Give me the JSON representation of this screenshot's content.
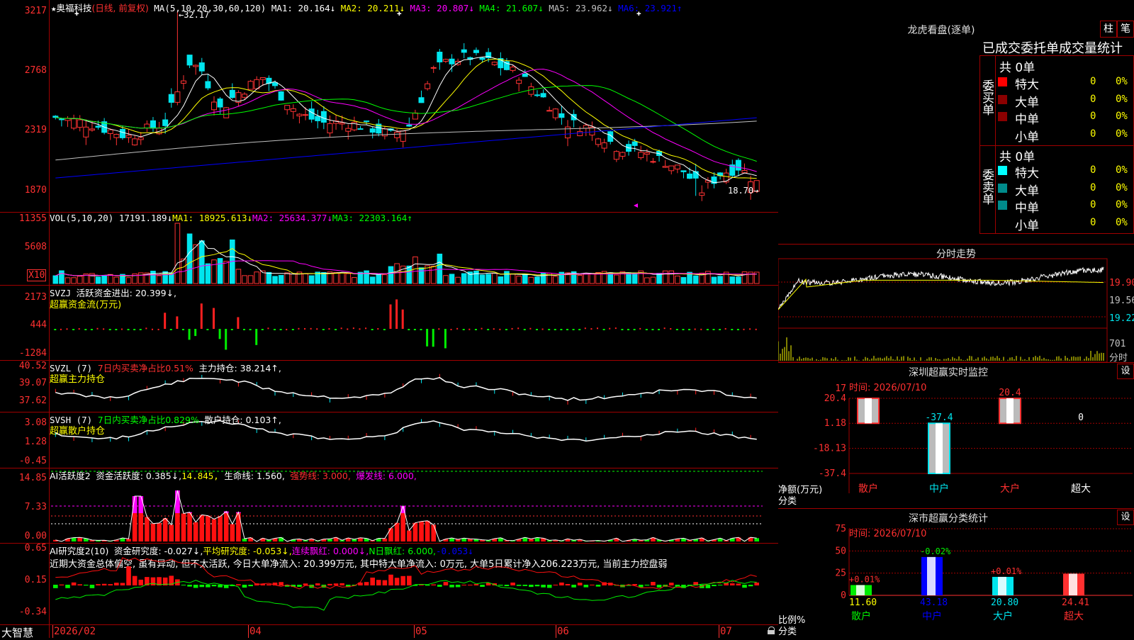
{
  "colors": {
    "up": "#ff3333",
    "down": "#00e5ee",
    "grid": "#a00000"
  },
  "kline": {
    "star": "★",
    "name": "奥福科技",
    "mode": "(日线, 前复权)",
    "ma_label": "MA(5,10,20,30,60,120)",
    "ma_values": [
      {
        "label": "MA1: 20.164↓",
        "color": "#ffffff"
      },
      {
        "label": "MA2: 20.211↓",
        "color": "#ffff00"
      },
      {
        "label": "MA3: 20.807↓",
        "color": "#ff00ff"
      },
      {
        "label": "MA4: 21.607↓",
        "color": "#00ff00"
      },
      {
        "label": "MA5: 23.962↓",
        "color": "#c0c0c0"
      },
      {
        "label": "MA6: 23.921↑",
        "color": "#0000ff"
      }
    ],
    "y_ticks": [
      "3217",
      "2768",
      "2319",
      "1870"
    ],
    "high_label": "←32.17",
    "low_label": "18.70→"
  },
  "volume": {
    "title": "VOL(5,10,20)",
    "value": "17191.189↓",
    "ma1": "MA1: 18925.613↓",
    "ma2": "MA2: 25634.377↓",
    "ma3": "MA3: 22303.164↑",
    "y_ticks": [
      "11355",
      "5608"
    ],
    "multiplier": "X10"
  },
  "svzj": {
    "title": "SVZJ",
    "desc": "活跃资金进出: 20.399↓,",
    "sub": "超赢资金流(万元)",
    "y_ticks": [
      "2173",
      "444",
      "-1284"
    ]
  },
  "svzl": {
    "title": "SVZL (7)",
    "desc": "7日内买卖净占比0.51%",
    "hold": "主力持仓: 38.214↑,",
    "sub": "超赢主力持仓",
    "y_ticks": [
      "40.52",
      "39.07",
      "37.62"
    ]
  },
  "svsh": {
    "title": "SVSH (7)",
    "desc": "7日内买卖净占比0.829%",
    "hold": "散户持仓: 0.103↑,",
    "sub": "超赢散户持仓",
    "y_ticks": [
      "3.08",
      "1.28",
      "-0.45"
    ]
  },
  "ai_active": {
    "title": "AI活跃度2",
    "fund": "资金活跃度: 0.385↓,",
    "v2": "14.845,",
    "life": "生命线: 1.560,",
    "strong": "强势线: 3.000,",
    "burst": "爆发线: 6.000,",
    "y_ticks": [
      "14.85",
      "7.33",
      "0.00"
    ]
  },
  "ai_research": {
    "title": "AI研究度2(10)",
    "fund": "资金研究度: -0.027↓,",
    "avg": "平均研究度: -0.053↓,",
    "cont": "连续飘红: 0.000↓,",
    "nday": "N日飘红: 6.000,",
    "neg": "-0.053↓",
    "summary": "近期大资金总体偏空, 虽有异动, 但不太活跃, 今日大单净流入: 20.399万元, 其中特大单净流入: 0万元, 大单5日累计净入206.223万元, 当前主力控盘弱",
    "y_ticks": [
      "0.65",
      "0.15",
      "-0.34"
    ]
  },
  "xaxis": {
    "labels": [
      "2026/02",
      "04",
      "05",
      "06",
      "07"
    ],
    "brand": "大智慧"
  },
  "dragon": {
    "title": "龙虎看盘(逐单)",
    "btn1": "柱",
    "btn2": "笔",
    "subtitle": "已成交委托单成交量统计",
    "buy_side": "委买单",
    "sell_side": "委卖单",
    "buy_total": "共 0单",
    "sell_total": "共 0单",
    "rows_buy": [
      {
        "label": "特大",
        "count": "0",
        "pct": "0%",
        "color": "#ff0000"
      },
      {
        "label": "大单",
        "count": "0",
        "pct": "0%",
        "color": "#8b0000"
      },
      {
        "label": "中单",
        "count": "0",
        "pct": "0%",
        "color": "#8b0000"
      },
      {
        "label": "小单",
        "count": "0",
        "pct": "0%",
        "color": ""
      }
    ],
    "rows_sell": [
      {
        "label": "特大",
        "count": "0",
        "pct": "0%",
        "color": "#00ffff"
      },
      {
        "label": "大单",
        "count": "0",
        "pct": "0%",
        "color": "#008b8b"
      },
      {
        "label": "中单",
        "count": "0",
        "pct": "0%",
        "color": "#008b8b"
      },
      {
        "label": "小单",
        "count": "0",
        "pct": "0%",
        "color": ""
      }
    ]
  },
  "intraday": {
    "title": "分时走势",
    "y_ticks": [
      "19.90",
      "19.56",
      "19.22"
    ],
    "vol_tick": "701",
    "vol_label": "分时"
  },
  "sz_monitor": {
    "title": "深圳超赢实时监控",
    "set": "设",
    "time": "时间: 2026/07/10",
    "y_ticks": [
      "20.4",
      "1.18",
      "-18.13",
      "-37.4"
    ],
    "y_top_extra": "17",
    "ylabel": "净额(万元)",
    "xlabel": "分类",
    "categories": [
      "散户",
      "中户",
      "大户",
      "超大"
    ],
    "values": [
      20.4,
      -37.4,
      20.4,
      0
    ],
    "value_labels": [
      "",
      "-37.4",
      "20.4",
      "0"
    ]
  },
  "sz_class": {
    "title": "深市超赢分类统计",
    "set": "设",
    "time": "时间: 2026/07/10",
    "y_ticks": [
      "75",
      "50",
      "25",
      "0"
    ],
    "ylabel": "比例%",
    "xlabel": "分类",
    "categories": [
      "散户",
      "中户",
      "大户",
      "超大"
    ],
    "values": [
      11.6,
      43.18,
      20.8,
      24.41
    ],
    "value_labels": [
      "11.60",
      "43.18",
      "20.80",
      "24.41"
    ],
    "change_labels": [
      "+0.01%",
      "-0.02%",
      "+0.01%",
      ""
    ]
  }
}
